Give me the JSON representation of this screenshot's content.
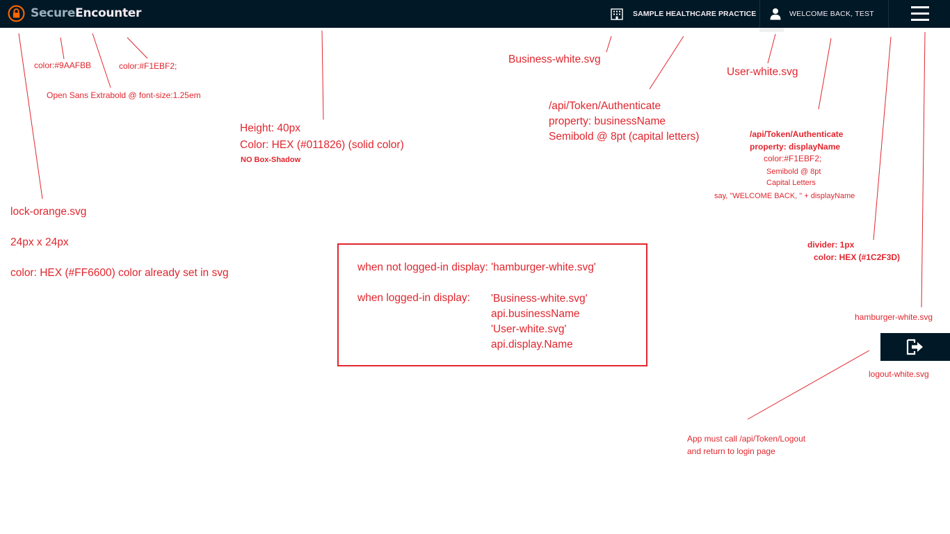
{
  "header": {
    "logo": {
      "part1": "Secure",
      "part2": "Encounter",
      "part1_color": "#9AAFBB",
      "part2_color": "#F1EBF2",
      "icon": "lock-icon",
      "icon_color": "#FF6600"
    },
    "business": {
      "icon": "building-icon",
      "name": "SAMPLE HEALTHCARE PRACTICE"
    },
    "user": {
      "icon": "user-icon",
      "greeting": "WELCOME BACK, TEST"
    },
    "menu_icon": "hamburger-icon",
    "background": "#011826",
    "divider_color": "#1C2F3D"
  },
  "logout": {
    "icon": "logout-icon"
  },
  "annotations": {
    "color_9aafbb": "color:#9AAFBB",
    "color_f1ebf2": "color:#F1EBF2;",
    "font_note": "Open Sans Extrabold @ font-size:1.25em",
    "bar_height": "Height: 40px",
    "bar_color": "Color: HEX (#011826)  (solid color)",
    "bar_shadow": "NO Box-Shadow",
    "lock_file": "lock-orange.svg",
    "lock_size": "24px x 24px",
    "lock_color": "color: HEX (#FF6600) color already set in svg",
    "business_file": "Business-white.svg",
    "business_api": "/api/Token/Authenticate",
    "business_prop": "property: businessName",
    "business_font": "Semibold @ 8pt (capital letters)",
    "user_file": "User-white.svg",
    "user_api": "/api/Token/Authenticate",
    "user_prop": "property: displayName",
    "user_color": "color:#F1EBF2;",
    "user_font": "Semibold  @ 8pt",
    "user_caps": "Capital Letters",
    "user_say": "say, \"WELCOME BACK, \" + displayName",
    "divider_size": "divider: 1px",
    "divider_color": "color: HEX (#1C2F3D)",
    "hamburger_file": "hamburger-white.svg",
    "logout_file": "logout-white.svg",
    "logout_note1": "App must call /api/Token/Logout",
    "logout_note2": "and return to login page"
  },
  "callout": {
    "not_logged_in": "when not logged-in display: 'hamburger-white.svg'",
    "logged_in_label": "when logged-in display:",
    "logged_in_items": [
      "'Business-white.svg'",
      "api.businessName",
      "'User-white.svg'",
      "api.display.Name"
    ]
  }
}
